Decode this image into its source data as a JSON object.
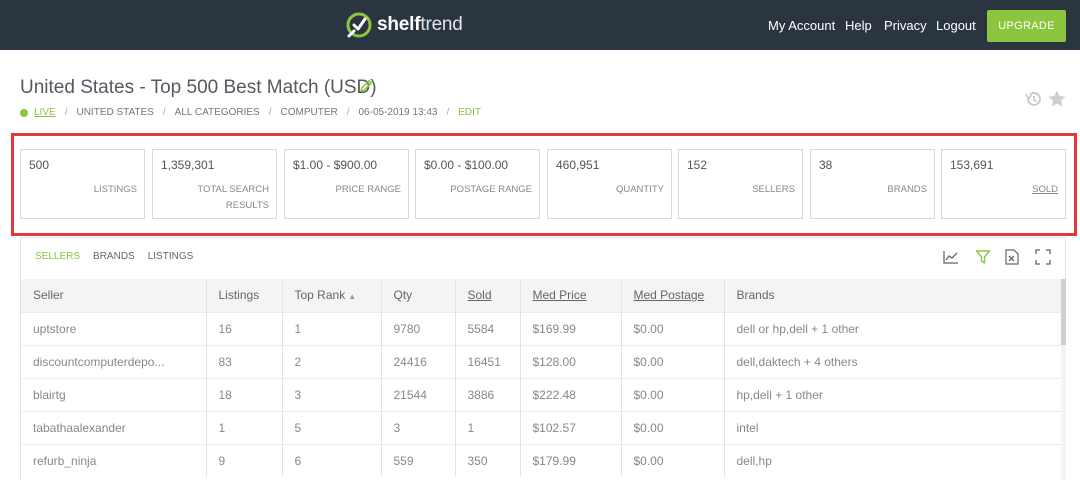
{
  "app": {
    "logo_bold": "shelf",
    "logo_light": "trend"
  },
  "nav": {
    "my_account": "My Account",
    "help": "Help",
    "privacy": "Privacy",
    "logout": "Logout",
    "upgrade": "UPGRADE"
  },
  "page": {
    "title": "United States - Top 500 Best Match (USD)"
  },
  "breadcrumb": {
    "live": "LIVE",
    "country": "UNITED STATES",
    "categories": "ALL CATEGORIES",
    "category": "COMPUTER",
    "datetime": "06-05-2019 13:43",
    "edit": "EDIT"
  },
  "stats": [
    {
      "value": "500",
      "label": "LISTINGS"
    },
    {
      "value": "1,359,301",
      "label": "TOTAL SEARCH RESULTS"
    },
    {
      "value": "$1.00 - $900.00",
      "label": "PRICE RANGE"
    },
    {
      "value": "$0.00 - $100.00",
      "label": "POSTAGE RANGE"
    },
    {
      "value": "460,951",
      "label": "QUANTITY"
    },
    {
      "value": "152",
      "label": "SELLERS"
    },
    {
      "value": "38",
      "label": "BRANDS"
    },
    {
      "value": "153,691",
      "label": "SOLD"
    }
  ],
  "tabs": [
    "SELLERS",
    "BRANDS",
    "LISTINGS"
  ],
  "table": {
    "headers": [
      "Seller",
      "Listings",
      "Top Rank",
      "Qty",
      "Sold",
      "Med Price",
      "Med Postage",
      "Brands"
    ],
    "sort_indicator": "▲",
    "rows": [
      [
        "uptstore",
        "16",
        "1",
        "9780",
        "5584",
        "$169.99",
        "$0.00",
        "dell or hp,dell + 1 other"
      ],
      [
        "discountcomputerdepo...",
        "83",
        "2",
        "24416",
        "16451",
        "$128.00",
        "$0.00",
        "dell,daktech + 4 others"
      ],
      [
        "blairtg",
        "18",
        "3",
        "21544",
        "3886",
        "$222.48",
        "$0.00",
        "hp,dell + 1 other"
      ],
      [
        "tabathaalexander",
        "1",
        "5",
        "3",
        "1",
        "$102.57",
        "$0.00",
        "intel"
      ],
      [
        "refurb_ninja",
        "9",
        "6",
        "559",
        "350",
        "$179.99",
        "$0.00",
        "dell,hp"
      ]
    ]
  },
  "colors": {
    "topbar": "#2b3540",
    "accent_green": "#8cc63f",
    "highlight_red": "#e03a3a"
  },
  "icons": [
    "logo-check-icon",
    "edit-pencil-icon",
    "history-icon",
    "star-icon",
    "chart-icon",
    "filter-icon",
    "excel-export-icon",
    "fullscreen-icon"
  ]
}
